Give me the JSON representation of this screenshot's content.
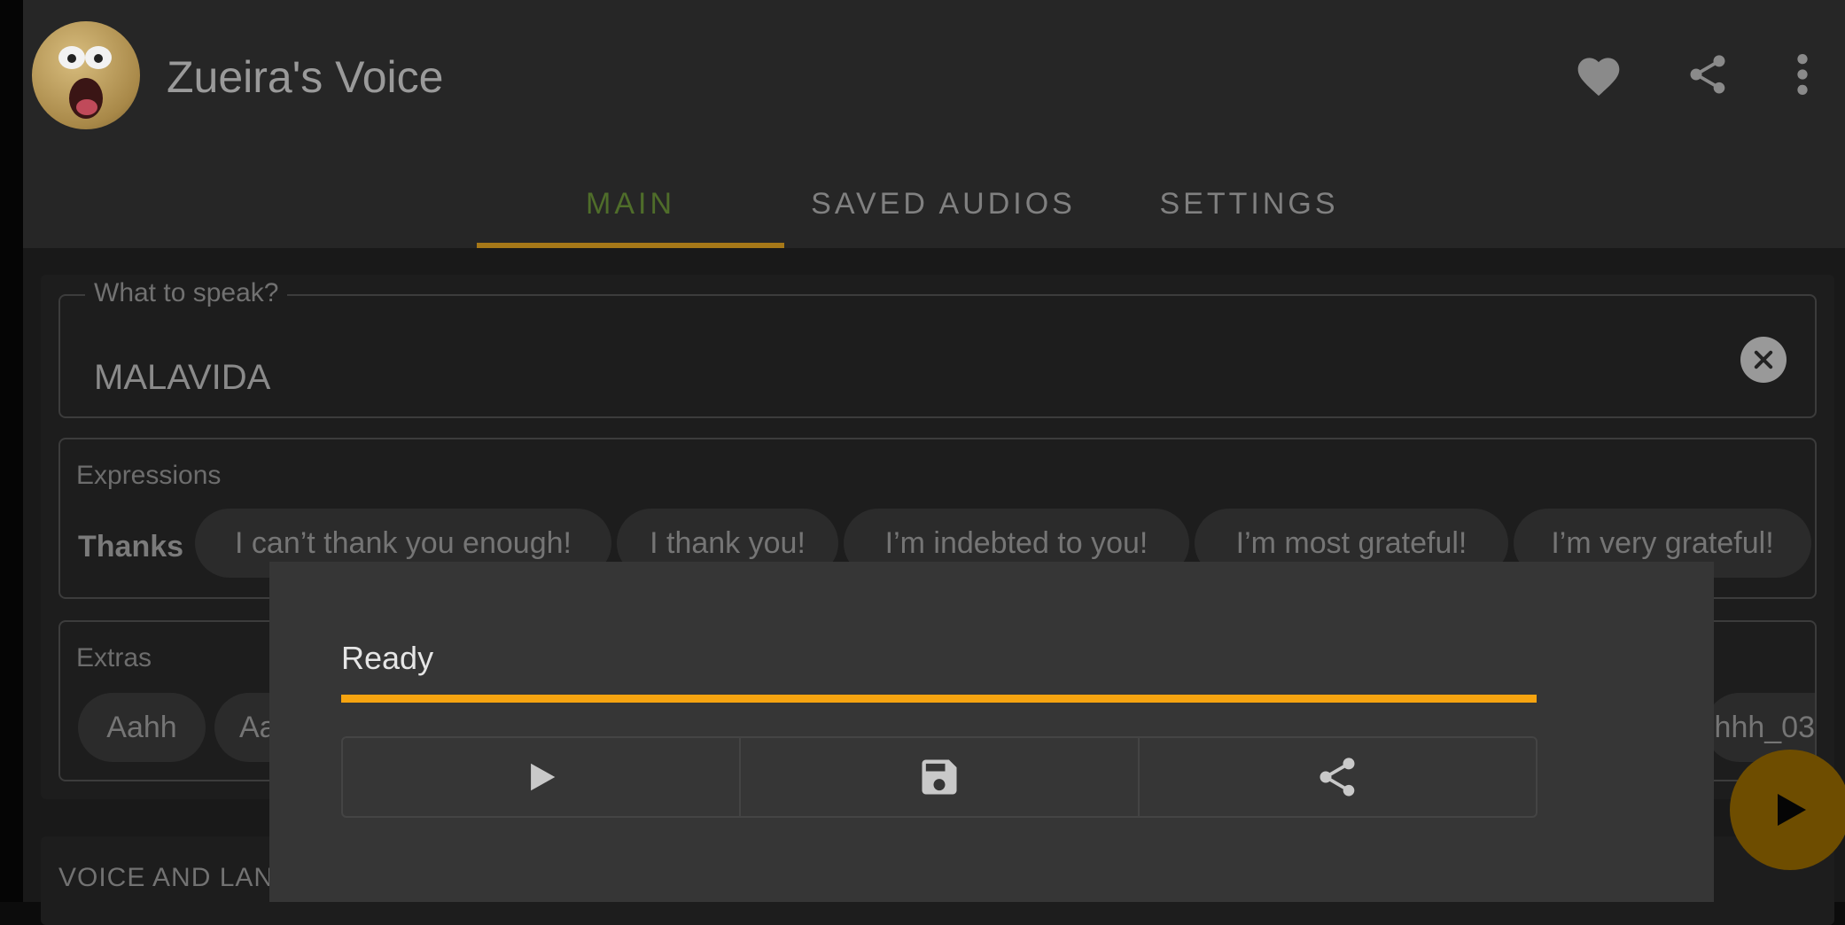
{
  "app": {
    "title": "Zueira's Voice",
    "avatar_icon": "shocked-face-avatar",
    "actions": [
      "heart-icon",
      "share-icon",
      "more-vert-icon"
    ]
  },
  "tabs": [
    {
      "label": "MAIN",
      "active": true
    },
    {
      "label": "SAVED AUDIOS",
      "active": false
    },
    {
      "label": "SETTINGS",
      "active": false
    }
  ],
  "speak_field": {
    "label": "What to speak?",
    "value": "MALAVIDA",
    "clear_icon": "clear-circle-icon"
  },
  "expressions": {
    "label": "Expressions",
    "row_label": "Thanks",
    "chips": [
      "I can’t thank you enough!",
      "I thank you!",
      "I’m indebted to you!",
      "I’m most grateful!",
      "I’m very grateful!"
    ]
  },
  "extras": {
    "label": "Extras",
    "chips": [
      "Aahh",
      "Aa",
      "hhh_03"
    ]
  },
  "voice_section": {
    "label": "VOICE AND LAN"
  },
  "fab": {
    "icon": "play-icon"
  },
  "dialog": {
    "status": "Ready",
    "progress": 1.0,
    "buttons": [
      "play-icon",
      "save-icon",
      "share-icon"
    ]
  },
  "colors": {
    "accent": "#f6a410",
    "active_tab": "#4f6d2a",
    "dialog_bg": "#363636"
  }
}
